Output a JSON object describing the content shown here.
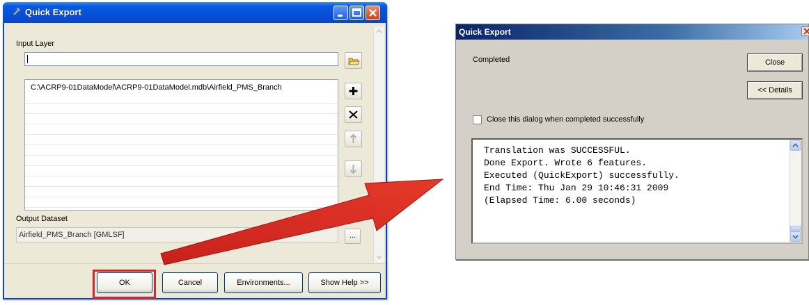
{
  "colors": {
    "xp_title_blue": "#0650d8",
    "classic_title_blue": "#0a246a",
    "highlight_red": "#d7262a",
    "arrow_red": "#e0231f"
  },
  "left_dialog": {
    "title": "Quick Export",
    "titlebar_icons": [
      "minimize-icon",
      "maximize-icon",
      "close-icon"
    ],
    "input_layer": {
      "label": "Input Layer",
      "value": "",
      "browse_icon": "open-folder-icon"
    },
    "layer_list": {
      "items": [
        "C:\\ACRP9-01DataModel\\ACRP9-01DataModel.mdb\\Airfield_PMS_Branch"
      ],
      "side_buttons": [
        "add-icon",
        "remove-icon",
        "move-up-icon",
        "move-down-icon"
      ]
    },
    "output_dataset": {
      "label": "Output Dataset",
      "value": "Airfield_PMS_Branch [GMLSF]",
      "browse_label": "..."
    },
    "buttons": {
      "ok": "OK",
      "cancel": "Cancel",
      "environments": "Environments...",
      "show_help": "Show Help >>"
    }
  },
  "right_dialog": {
    "title": "Quick Export",
    "status": "Completed",
    "close_button": "Close",
    "details_button": "<< Details",
    "close_when_done": {
      "label": "Close this dialog when completed successfully",
      "checked": false
    },
    "log_lines": [
      "Translation was SUCCESSFUL.",
      "Done Export.  Wrote 6 features.",
      "Executed (QuickExport) successfully.",
      "End Time: Thu Jan 29 10:46:31 2009",
      "(Elapsed Time: 6.00 seconds)"
    ]
  }
}
